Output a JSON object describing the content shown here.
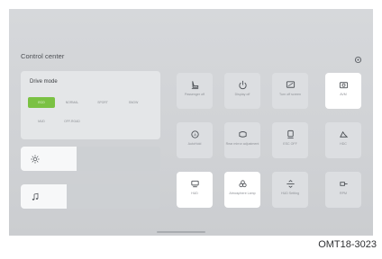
{
  "screen": {
    "title": "Control center",
    "home_indicator": "home-bar"
  },
  "drive_mode": {
    "title": "Drive mode",
    "row1": [
      "ECO",
      "NORMAL",
      "SPORT",
      "SNOW"
    ],
    "row2": [
      "MUD",
      "OFF-ROAD"
    ],
    "selected": "ECO",
    "accent_color": "#7ac143"
  },
  "sliders": {
    "brightness": {
      "icon": "sun-icon",
      "level_percent": 40
    },
    "volume": {
      "icon": "music-note-icon",
      "level_percent": 33
    }
  },
  "tiles": [
    {
      "label": "Passenger off",
      "icon": "seat-icon",
      "active": false
    },
    {
      "label": "Display off",
      "icon": "power-icon",
      "active": false
    },
    {
      "label": "Turn off screen",
      "icon": "screen-icon",
      "active": false
    },
    {
      "label": "AVM",
      "icon": "camera-icon",
      "active": true
    },
    {
      "label": "AutoHold",
      "icon": "autohold-icon",
      "active": false
    },
    {
      "label": "Rear mirror adjustment",
      "icon": "mirror-icon",
      "active": false
    },
    {
      "label": "ESC OFF",
      "icon": "esc-icon",
      "active": false
    },
    {
      "label": "HDC",
      "icon": "hdc-icon",
      "active": false
    },
    {
      "label": "HUD",
      "icon": "hud-icon",
      "active": true
    },
    {
      "label": "Atmosphere Lamp",
      "icon": "lamp-icon",
      "active": true
    },
    {
      "label": "HUD Setting",
      "icon": "hud-setting-icon",
      "active": false
    },
    {
      "label": "RPM",
      "icon": "rpm-icon",
      "active": false
    }
  ],
  "caption": "OMT18-3023"
}
